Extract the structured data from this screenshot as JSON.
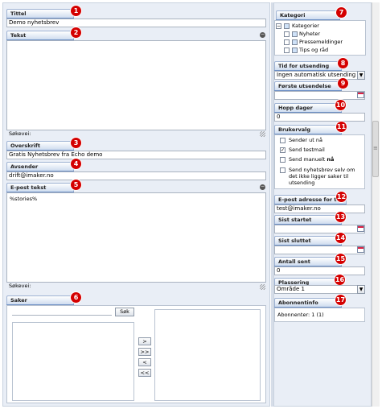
{
  "left": {
    "tittel": {
      "label": "Tittel",
      "badge": "1",
      "value": "Demo nyhetsbrev"
    },
    "tekst": {
      "label": "Tekst",
      "badge": "2",
      "path_label": "Søkevei:"
    },
    "overskrift": {
      "label": "Overskrift",
      "badge": "3",
      "value": "Gratis Nyhetsbrev fra Echo demo"
    },
    "avsender": {
      "label": "Avsender",
      "badge": "4",
      "value": "drift@imaker.no"
    },
    "epost_tekst": {
      "label": "E-post tekst",
      "badge": "5",
      "value": "%stories%",
      "path_label": "Søkevei:"
    },
    "saker": {
      "label": "Saker",
      "badge": "6",
      "search_button": "Søk",
      "move_buttons": [
        ">",
        ">>",
        "<",
        "<<"
      ]
    }
  },
  "right": {
    "kategori": {
      "label": "Kategori",
      "badge": "7",
      "root": "Kategorier",
      "items": [
        "Nyheter",
        "Pressemeldinger",
        "Tips og råd"
      ]
    },
    "tid": {
      "label": "Tid for utsending",
      "badge": "8",
      "value": "Ingen automatisk utsending"
    },
    "forste": {
      "label": "Første utsendelse",
      "badge": "9"
    },
    "hopp": {
      "label": "Hopp dager",
      "badge": "10",
      "value": "0"
    },
    "brukervalg": {
      "label": "Brukervalg",
      "badge": "11",
      "opt1": "Sender ut nå",
      "opt2": "Send testmail",
      "opt3_prefix": "Send manuelt ",
      "opt3_bold": "nå",
      "opt4_l1": "Send nyhetsbrev selv om",
      "opt4_l2": "det ikke ligger saker til",
      "opt4_l3": "utsending"
    },
    "test": {
      "label": "E-post adresse for test",
      "badge": "12",
      "value": "test@imaker.no"
    },
    "sist_startet": {
      "label": "Sist startet",
      "badge": "13"
    },
    "sist_sluttet": {
      "label": "Sist sluttet",
      "badge": "14"
    },
    "antall": {
      "label": "Antall sent",
      "badge": "15",
      "value": "0"
    },
    "plassering": {
      "label": "Plassering",
      "badge": "16",
      "value": "Område 1"
    },
    "abonnent": {
      "label": "Abonnentinfo",
      "badge": "17",
      "value": "Abonnenter: 1 (1)"
    }
  },
  "colors": {
    "badge": "#d40000",
    "tab_underline": "#6c8fc4",
    "panel_bg": "#e9eef6"
  }
}
